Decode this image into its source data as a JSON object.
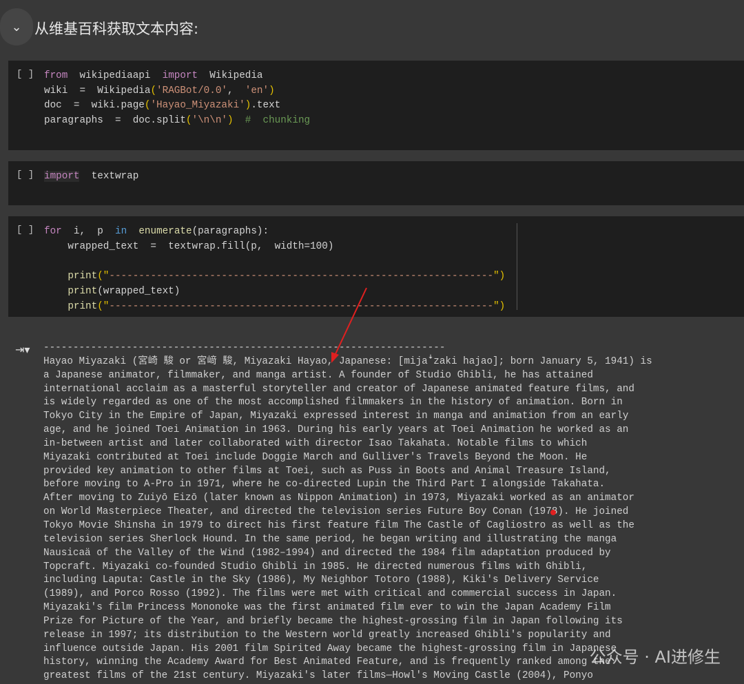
{
  "section": {
    "title": "从维基百科获取文本内容:",
    "toggle_icon": "chevron-down-icon"
  },
  "cells": [
    {
      "bracket": "[ ]"
    },
    {
      "bracket": "[ ]"
    },
    {
      "bracket": "[ ]"
    }
  ],
  "code1": {
    "l1": [
      "from",
      "wikipediaapi",
      "import",
      "Wikipedia"
    ],
    "l2": [
      "wiki  =  Wikipedia",
      "(",
      "'RAGBot/0.0'",
      ",  ",
      "'en'",
      ")"
    ],
    "l3": [
      "doc  =  wiki.page",
      "(",
      "'Hayao_Miyazaki'",
      ")",
      ".text"
    ],
    "l4": [
      "paragraphs  =  doc.split",
      "(",
      "'\\n\\n'",
      ")",
      "  #  chunking"
    ]
  },
  "code2": {
    "l1": [
      "import",
      "textwrap"
    ]
  },
  "code3": {
    "l1": [
      "for",
      "i,  p",
      "in",
      "enumerate",
      "(paragraphs):"
    ],
    "l2": "    wrapped_text  =  textwrap.fill(p,  width=100)",
    "l3": [
      "    print",
      "(\"",
      "-----------------------------------------------------------------",
      "\")"
    ],
    "l4": [
      "    print",
      "(wrapped_text)"
    ],
    "l5": [
      "    print",
      "(\"",
      "-----------------------------------------------------------------",
      "\")"
    ]
  },
  "output": {
    "text": "--------------------------------------------------------------------\nHayao Miyazaki (宮崎 駿 or 宮﨑 駿, Miyazaki Hayao, Japanese: [mijaꜜzaki hajao]; born January 5, 1941) is\na Japanese animator, filmmaker, and manga artist. A founder of Studio Ghibli, he has attained\ninternational acclaim as a masterful storyteller and creator of Japanese animated feature films, and\nis widely regarded as one of the most accomplished filmmakers in the history of animation. Born in\nTokyo City in the Empire of Japan, Miyazaki expressed interest in manga and animation from an early\nage, and he joined Toei Animation in 1963. During his early years at Toei Animation he worked as an\nin-between artist and later collaborated with director Isao Takahata. Notable films to which\nMiyazaki contributed at Toei include Doggie March and Gulliver's Travels Beyond the Moon. He\nprovided key animation to other films at Toei, such as Puss in Boots and Animal Treasure Island,\nbefore moving to A-Pro in 1971, where he co-directed Lupin the Third Part I alongside Takahata.\nAfter moving to Zuiyō Eizō (later known as Nippon Animation) in 1973, Miyazaki worked as an animator\non World Masterpiece Theater, and directed the television series Future Boy Conan (1978). He joined\nTokyo Movie Shinsha in 1979 to direct his first feature film The Castle of Cagliostro as well as the\ntelevision series Sherlock Hound. In the same period, he began writing and illustrating the manga\nNausicaä of the Valley of the Wind (1982–1994) and directed the 1984 film adaptation produced by\nTopcraft. Miyazaki co-founded Studio Ghibli in 1985. He directed numerous films with Ghibli,\nincluding Laputa: Castle in the Sky (1986), My Neighbor Totoro (1988), Kiki's Delivery Service\n(1989), and Porco Rosso (1992). The films were met with critical and commercial success in Japan.\nMiyazaki's film Princess Mononoke was the first animated film ever to win the Japan Academy Film\nPrize for Picture of the Year, and briefly became the highest-grossing film in Japan following its\nrelease in 1997; its distribution to the Western world greatly increased Ghibli's popularity and\ninfluence outside Japan. His 2001 film Spirited Away became the highest-grossing film in Japanese\nhistory, winning the Academy Award for Best Animated Feature, and is frequently ranked among the\ngreatest films of the 21st century. Miyazaki's later films—Howl's Moving Castle (2004), Ponyo"
  },
  "watermark": "公众号 · AI进修生",
  "colors": {
    "annotation": "#e02020"
  }
}
